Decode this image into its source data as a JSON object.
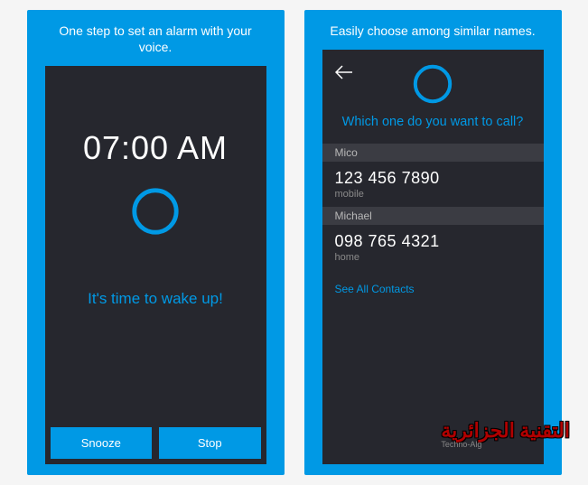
{
  "left": {
    "caption": "One step to set an alarm with your voice.",
    "time": "07:00 AM",
    "message": "It's time to wake up!",
    "snooze_label": "Snooze",
    "stop_label": "Stop"
  },
  "right": {
    "caption": "Easily choose among similar names.",
    "prompt": "Which one do you want to call?",
    "contacts": [
      {
        "name": "Mico",
        "number": "123 456 7890",
        "type": "mobile"
      },
      {
        "name": "Michael",
        "number": "098 765 4321",
        "type": "home"
      }
    ],
    "see_all": "See All Contacts"
  },
  "colors": {
    "accent": "#0099e5",
    "screen_bg": "#26272e"
  },
  "watermark": {
    "top": "التقنية الجزائرية",
    "sub": "Techno-Alg"
  }
}
